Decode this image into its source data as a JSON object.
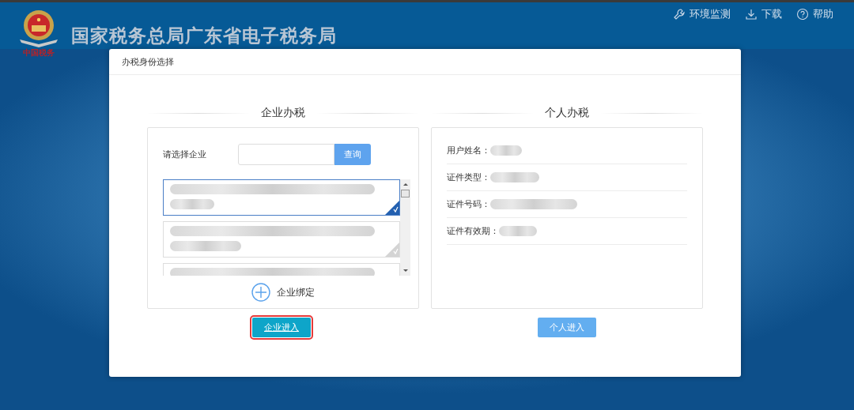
{
  "header": {
    "logo_caption": "中国税务",
    "site_title": "国家税务总局广东省电子税务局",
    "nav": [
      {
        "kind": "wrench",
        "label": "环境监测"
      },
      {
        "kind": "download",
        "label": "下载"
      },
      {
        "kind": "help",
        "label": "帮助"
      }
    ]
  },
  "dialog": {
    "title": "办税身份选择",
    "enterprise": {
      "heading": "企业办税",
      "search_label": "请选择企业",
      "search_button": "查询",
      "companies": [
        {
          "selected": true
        },
        {
          "selected": false
        },
        {
          "selected": false
        }
      ],
      "bind_label": "企业绑定",
      "enter_button": {
        "label": "企业进入",
        "highlighted": true
      }
    },
    "personal": {
      "heading": "个人办税",
      "fields": [
        {
          "label": "用户姓名："
        },
        {
          "label": "证件类型："
        },
        {
          "label": "证件号码："
        },
        {
          "label": "证件有效期："
        }
      ],
      "enter_button": {
        "label": "个人进入",
        "highlighted": false
      }
    }
  }
}
